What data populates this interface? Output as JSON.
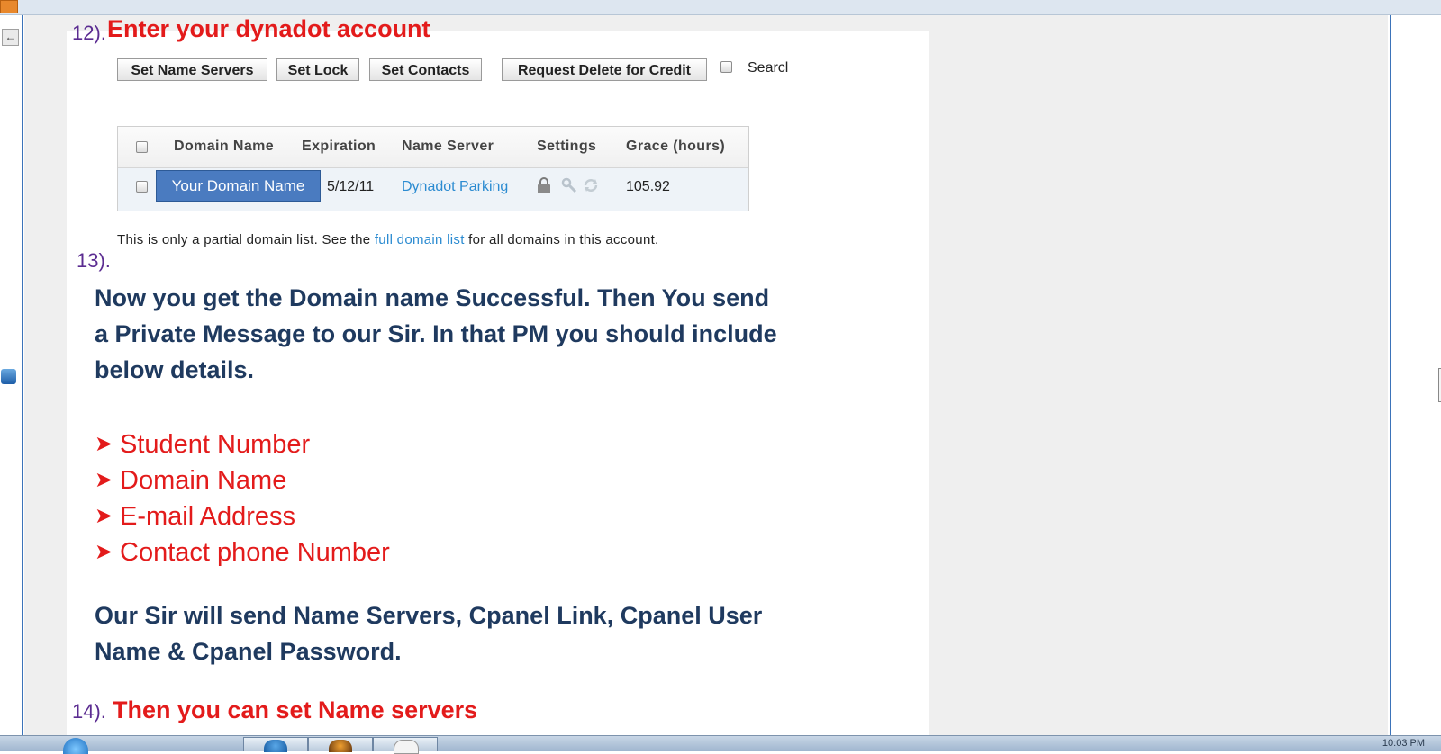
{
  "steps": {
    "step12": {
      "number": "12).",
      "heading": "Enter your dynadot account"
    },
    "step13": {
      "number": "13).",
      "paragraph_lines": [
        "Now you get the Domain name Successful. Then You send",
        "a Private Message to our Sir. In that PM you should include",
        "below details."
      ]
    },
    "step14": {
      "number": "14).",
      "heading": "Then you can set Name servers"
    }
  },
  "toolbar": {
    "set_name_servers": "Set Name Servers",
    "set_lock": "Set Lock",
    "set_contacts": "Set Contacts",
    "request_delete": "Request Delete for Credit",
    "search_label": "Searcl"
  },
  "domain_table": {
    "headers": [
      "Domain Name",
      "Expiration",
      "Name Server",
      "Settings",
      "Grace (hours)"
    ],
    "row": {
      "domain": "Your Domain Name",
      "expiration": "5/12/11",
      "name_server": "Dynadot Parking",
      "grace": "105.92"
    }
  },
  "partial_note": {
    "prefix": "This is only a partial domain list. See the",
    "link": "full domain list",
    "suffix": "for all domains in this account."
  },
  "details_list": [
    "Student Number",
    "Domain Name",
    "E-mail Address",
    "Contact phone Number"
  ],
  "closing_lines": [
    "Our Sir will send Name Servers, Cpanel Link, Cpanel User",
    "Name & Cpanel Password."
  ],
  "taskbar": {
    "clock": "10:03 PM"
  },
  "colors": {
    "heading_red": "#e31b1b",
    "step_purple": "#5b2c91",
    "paragraph_navy": "#1f3a5f",
    "link_blue": "#2b8bd1",
    "domain_highlight": "#4a7bc0"
  }
}
